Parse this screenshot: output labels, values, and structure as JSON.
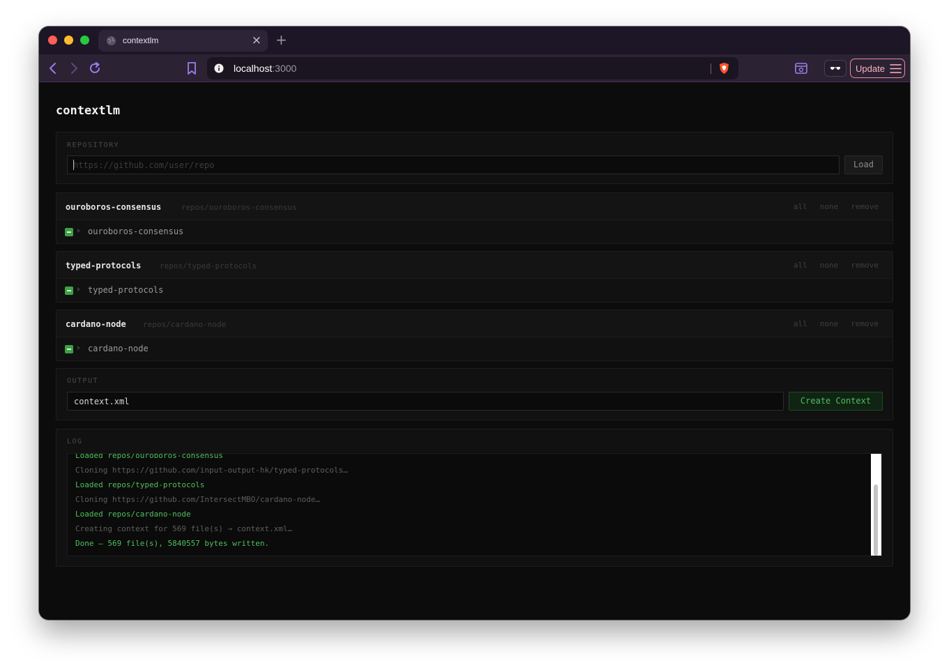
{
  "browser": {
    "tab_title": "contextlm",
    "url_host": "localhost",
    "url_port": ":3000",
    "update_label": "Update",
    "colors": {
      "accent": "#f08aa0",
      "tab_bg": "#2d2438",
      "toolbar_bg": "#2b2233"
    },
    "icons": [
      "back-icon",
      "forward-icon",
      "reload-icon",
      "bookmark-icon",
      "info-icon",
      "brave-shield-icon",
      "sidebar-icon",
      "extension-icon",
      "menu-icon"
    ]
  },
  "app": {
    "title": "contextlm",
    "repository": {
      "label": "REPOSITORY",
      "placeholder": "https://github.com/user/repo",
      "value": "",
      "load_label": "Load"
    },
    "repos": [
      {
        "name": "ouroboros-consensus",
        "path": "repos/ouroboros-consensus",
        "all": "all",
        "none": "none",
        "remove": "remove",
        "row": "ouroboros-consensus"
      },
      {
        "name": "typed-protocols",
        "path": "repos/typed-protocols",
        "all": "all",
        "none": "none",
        "remove": "remove",
        "row": "typed-protocols"
      },
      {
        "name": "cardano-node",
        "path": "repos/cardano-node",
        "all": "all",
        "none": "none",
        "remove": "remove",
        "row": "cardano-node"
      }
    ],
    "output": {
      "label": "OUTPUT",
      "value": "context.xml",
      "create_label": "Create Context"
    },
    "log": {
      "label": "LOG",
      "lines": [
        {
          "text": "Loaded repos/ouroboros-consensus",
          "kind": "ok"
        },
        {
          "text": "Cloning https://github.com/input-output-hk/typed-protocols…",
          "kind": "info"
        },
        {
          "text": "Loaded repos/typed-protocols",
          "kind": "ok"
        },
        {
          "text": "Cloning https://github.com/IntersectMBO/cardano-node…",
          "kind": "info"
        },
        {
          "text": "Loaded repos/cardano-node",
          "kind": "ok"
        },
        {
          "text": "Creating context for 569 file(s) → context.xml…",
          "kind": "info"
        },
        {
          "text": "Done — 569 file(s), 5840557 bytes written.",
          "kind": "ok"
        }
      ]
    },
    "colors": {
      "ok": "#4fbf5d",
      "info": "#5e5e5e",
      "checkbox": "#3fa047"
    }
  }
}
